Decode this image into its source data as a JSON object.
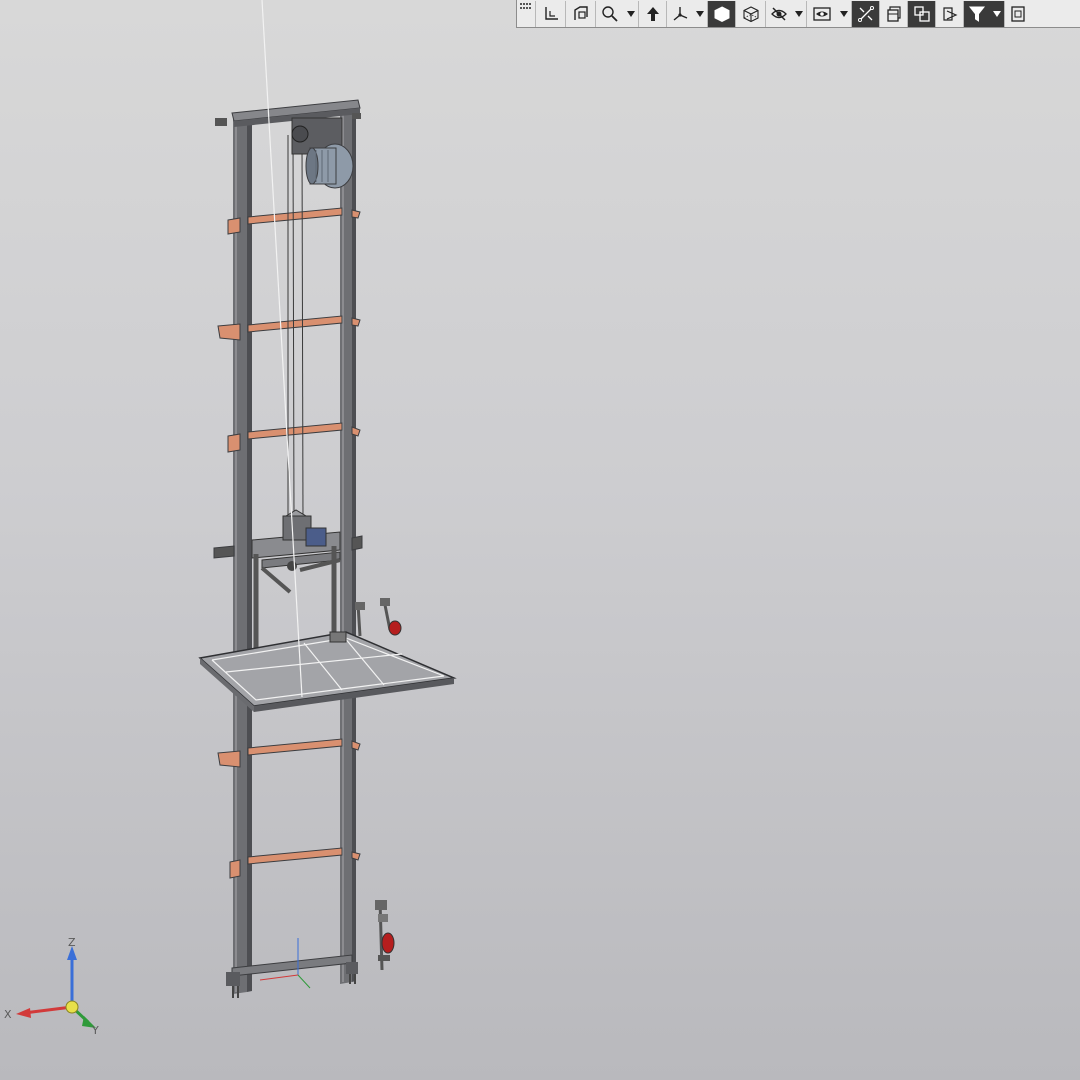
{
  "toolbar": {
    "buttons": [
      {
        "name": "grip-handle",
        "icon": "grip-icon"
      },
      {
        "name": "orientation-button",
        "icon": "orientation-icon"
      },
      {
        "name": "normal-to-button",
        "icon": "normal-to-icon"
      },
      {
        "name": "zoom-button",
        "icon": "magnifier-icon",
        "dropdown": true
      },
      {
        "name": "pan-button",
        "icon": "pan-arrow-icon"
      },
      {
        "name": "rotate-button",
        "icon": "rotate-axes-icon",
        "dropdown": true
      },
      {
        "name": "shaded-with-edges-button",
        "icon": "solid-cube-icon",
        "active": true
      },
      {
        "name": "wireframe-button",
        "icon": "wire-cube-icon"
      },
      {
        "name": "hide-show-button",
        "icon": "eye-slash-icon",
        "dropdown": true
      },
      {
        "name": "display-mode-button",
        "icon": "display-eye-icon",
        "dropdown": true
      },
      {
        "name": "perspective-button",
        "icon": "perspective-icon",
        "active": true
      },
      {
        "name": "section-button",
        "icon": "section-icon"
      },
      {
        "name": "components-button",
        "icon": "components-icon",
        "active": true
      },
      {
        "name": "layers-button",
        "icon": "layers-icon"
      },
      {
        "name": "filter-button",
        "icon": "filter-icon",
        "dropdown": true,
        "active": true
      },
      {
        "name": "more-button",
        "icon": "overflow-icon"
      }
    ]
  },
  "triad": {
    "x_label": "X",
    "y_label": "Y",
    "z_label": "Z",
    "colors": {
      "x": "#d23a3a",
      "y": "#2f9a3a",
      "z": "#3a6fd8",
      "origin": "#e8e04a"
    }
  },
  "scene": {
    "frame_color": "#6e6f73",
    "rung_color": "#d99070",
    "platform_color": "#a3a4a8",
    "motor_color": "#8e9aa8",
    "accent_red": "#b51e1e"
  }
}
